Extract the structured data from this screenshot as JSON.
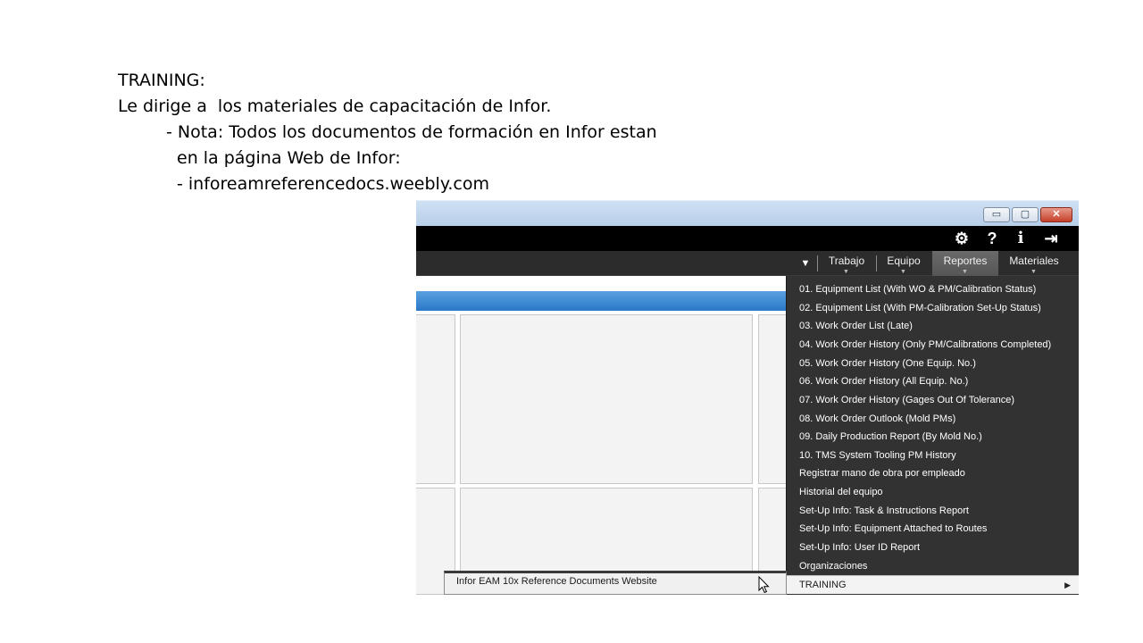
{
  "slide": {
    "lines": [
      "TRAINING:",
      "Le dirige a  los materiales de capacitación de Infor.",
      "- Nota: Todos los documentos de formación en Infor estan",
      "en la página Web de Infor:",
      "- inforeamreferencedocs.weebly.com"
    ]
  },
  "window": {
    "min_glyph": "▭",
    "max_glyph": "▢",
    "close_glyph": "✕"
  },
  "toolbar": {
    "icons": [
      "gear-icon",
      "help-icon",
      "info-icon",
      "logout-icon"
    ],
    "gear_glyph": "⚙",
    "help_glyph": "?",
    "info_glyph": "i",
    "logout_glyph": "⇥"
  },
  "nav": {
    "caret_glyph": "▼",
    "tabs": [
      "Trabajo",
      "Equipo",
      "Reportes",
      "Materiales"
    ],
    "active_tab": "Reportes"
  },
  "menu": {
    "items": [
      "01. Equipment List (With WO & PM/Calibration Status)",
      "02. Equipment List (With PM-Calibration Set-Up Status)",
      "03. Work Order List (Late)",
      "04. Work Order History (Only PM/Calibrations Completed)",
      "05. Work Order History (One Equip. No.)",
      "06. Work Order History (All Equip. No.)",
      "07. Work Order History (Gages Out Of Tolerance)",
      "08. Work Order Outlook (Mold PMs)",
      "09. Daily Production Report (By Mold No.)",
      "10. TMS System Tooling PM History",
      "Registrar mano de obra por empleado",
      "Historial del equipo",
      "Set-Up Info: Task & Instructions Report",
      "Set-Up Info: Equipment Attached to Routes",
      "Set-Up Info: User ID Report",
      "Organizaciones"
    ],
    "training_label": "TRAINING",
    "training_arrow": "▶"
  },
  "submenu": {
    "item": "Infor EAM 10x Reference Documents Website"
  },
  "colors": {
    "menu_bg": "#323232",
    "topbar_bg": "#000000",
    "accent_blue": "#2a78c8"
  }
}
